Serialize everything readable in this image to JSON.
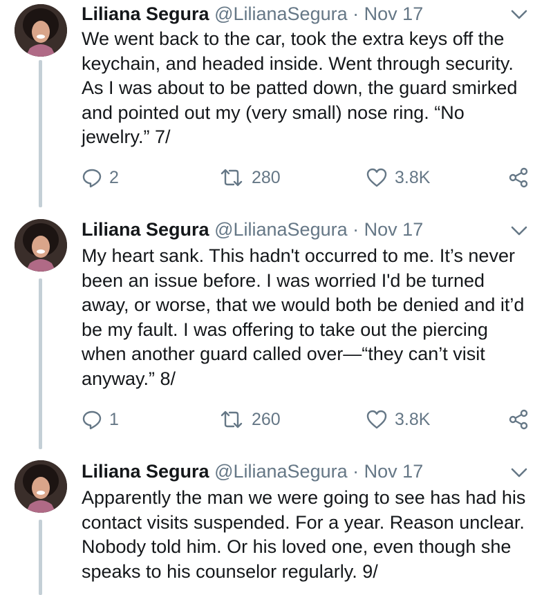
{
  "tweets": [
    {
      "name": "Liliana Segura",
      "handle": "@LilianaSegura",
      "separator": "·",
      "date": "Nov 17",
      "text": "We went back to the car, took the extra keys off the\nkeychain, and headed inside. Went through security.\nAs I was about to be patted down, the guard smirked\nand pointed out my (very small) nose ring. “No\njewelry.” 7/",
      "replies": "2",
      "retweets": "280",
      "likes": "3.8K"
    },
    {
      "name": "Liliana Segura",
      "handle": "@LilianaSegura",
      "separator": "·",
      "date": "Nov 17",
      "text": "My heart sank. This hadn't occurred to me. It’s never\nbeen an issue before. I was worried I'd be turned\naway, or worse, that we would both be denied and it’d\nbe my fault. I was offering to take out the piercing\nwhen another guard called over—“they can’t visit\nanyway.” 8/",
      "replies": "1",
      "retweets": "260",
      "likes": "3.8K"
    },
    {
      "name": "Liliana Segura",
      "handle": "@LilianaSegura",
      "separator": "·",
      "date": "Nov 17",
      "text": "Apparently the man we were going to see has had his\ncontact visits suspended. For a year. Reason unclear.\nNobody told him. Or his loved one, even though she\nspeaks to his counselor regularly. 9/"
    }
  ],
  "colors": {
    "text": "#14171a",
    "secondary": "#657786",
    "thread_line": "#c4cfd6"
  },
  "icons": [
    "reply-icon",
    "retweet-icon",
    "like-icon",
    "share-icon",
    "chevron-down-icon"
  ]
}
